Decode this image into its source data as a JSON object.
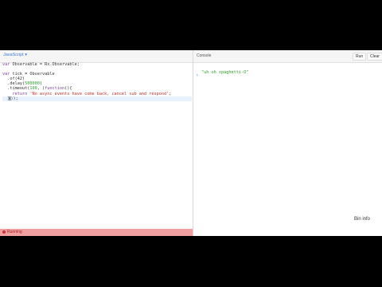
{
  "js_panel": {
    "label": "JavaScript ▾",
    "code_lines": [
      [
        {
          "t": "var",
          "c": "kw"
        },
        {
          "t": " Observable = Rx.Observable;"
        }
      ],
      [],
      [
        {
          "t": "var",
          "c": "kw"
        },
        {
          "t": " tick = Observable"
        }
      ],
      [
        {
          "t": "  .of(42)"
        }
      ],
      [
        {
          "t": "  .delay("
        },
        {
          "t": "500000",
          "c": "num"
        },
        {
          "t": ")"
        }
      ],
      [
        {
          "t": "  .timeout("
        },
        {
          "t": "100",
          "c": "num"
        },
        {
          "t": ", ("
        },
        {
          "t": "function",
          "c": "kw"
        },
        {
          "t": "(){"
        }
      ],
      [
        {
          "t": "    "
        },
        {
          "t": "return",
          "c": "kw"
        },
        {
          "t": " "
        },
        {
          "t": "'No async events have come back, cancel sub and respond'",
          "c": "str"
        },
        {
          "t": ";"
        }
      ],
      [
        {
          "t": "  }"
        },
        {
          "t": "cursor",
          "c": "cursor"
        },
        {
          "t": "));"
        }
      ]
    ],
    "active_line": 7,
    "status_text": "Running"
  },
  "console": {
    "label": "Console",
    "run_label": "Run",
    "clear_label": "Clear",
    "output": "\"uh oh spaghetti-O\"",
    "prompt": "›"
  },
  "bin_info_label": "Bin info",
  "colors": {
    "accent": "#3e7bd6",
    "error_bar": "#f0a0a0",
    "keyword": "#7a3e9d",
    "string": "#c03030",
    "number": "#2a9d2a"
  }
}
